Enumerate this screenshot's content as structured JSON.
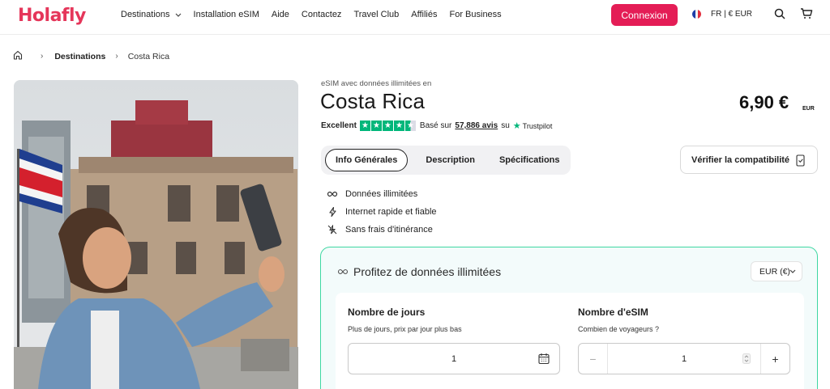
{
  "header": {
    "logo": "Holafly",
    "nav": [
      {
        "label": "Destinations",
        "has_dropdown": true
      },
      {
        "label": "Installation eSIM"
      },
      {
        "label": "Aide"
      },
      {
        "label": "Contactez"
      },
      {
        "label": "Travel Club"
      },
      {
        "label": "Affiliés"
      },
      {
        "label": "For Business"
      }
    ],
    "login_label": "Connexion",
    "locale_label": "FR | € EUR",
    "accent_color": "#e41d56"
  },
  "breadcrumb": {
    "home_icon": "home-icon",
    "section": "Destinations",
    "current": "Costa Rica"
  },
  "product": {
    "subtitle": "eSIM avec données illimitées en",
    "title": "Costa Rica",
    "rating_label": "Excellent",
    "rating_stars": 4.5,
    "based_on": "Basé sur",
    "reviews": "57,886 avis",
    "on": "su",
    "trustpilot": "Trustpilot",
    "price": "6,90 €",
    "currency": "EUR"
  },
  "tabs": [
    {
      "label": "Info Générales",
      "active": true
    },
    {
      "label": "Description",
      "active": false
    },
    {
      "label": "Spécifications",
      "active": false
    }
  ],
  "compat_label": "Vérifier la compatibilité",
  "features": [
    {
      "icon": "infinity-icon",
      "label": "Données illimitées"
    },
    {
      "icon": "lightning-icon",
      "label": "Internet rapide et fiable"
    },
    {
      "icon": "no-roaming-icon",
      "label": "Sans frais d'itinérance"
    }
  ],
  "plan_card": {
    "title": "Profitez de données illimitées",
    "currency_select": "EUR (€)",
    "days": {
      "label": "Nombre de jours",
      "help": "Plus de jours, prix par jour plus bas",
      "value": "1"
    },
    "esims": {
      "label": "Nombre d'eSIM",
      "help": "Combien de voyageurs ?",
      "value": "1",
      "minus": "−",
      "plus": "+"
    },
    "border_color": "#3ed7a2"
  }
}
